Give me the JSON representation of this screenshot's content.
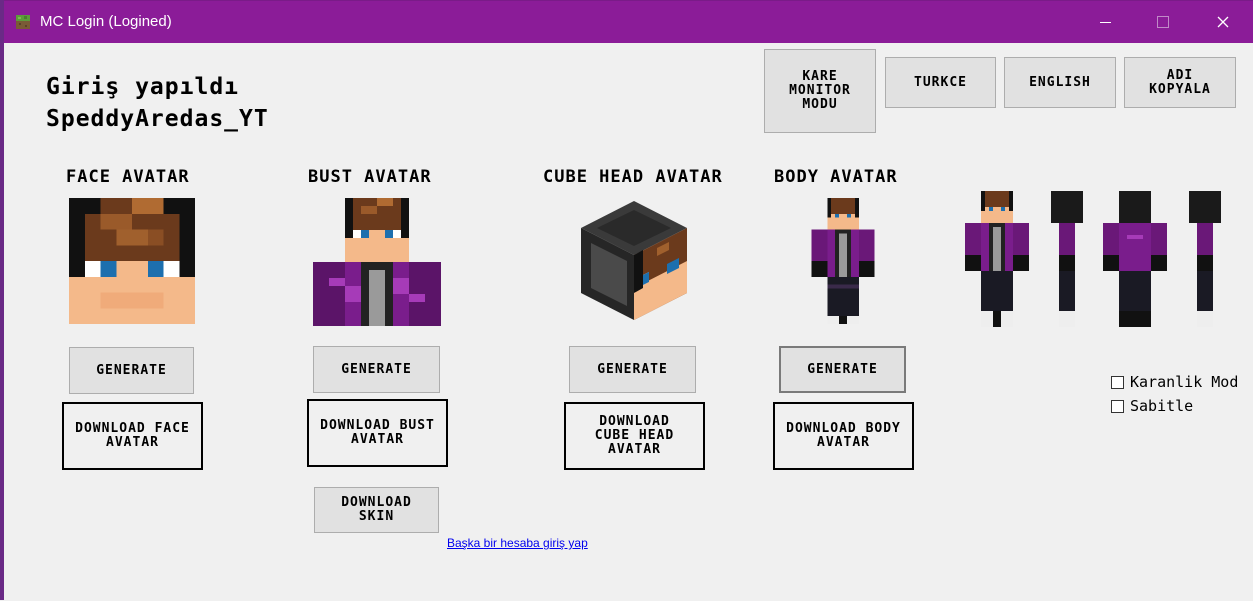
{
  "window": {
    "title": "MC Login (Logined)"
  },
  "status": {
    "line1": "Giriş yapıldı",
    "username": "SpeddyAredas_YT"
  },
  "top_buttons": {
    "square_monitor": "KARE MONITOR MODU",
    "turkce": "TURKCE",
    "english": "ENGLISH",
    "copy_name": "ADI KOPYALA"
  },
  "sections": {
    "face": {
      "title": "FACE AVATAR",
      "generate": "GENERATE",
      "download": "DOWNLOAD FACE AVATAR"
    },
    "bust": {
      "title": "BUST AVATAR",
      "generate": "GENERATE",
      "download": "DOWNLOAD BUST AVATAR",
      "download_skin": "DOWNLOAD SKIN"
    },
    "cube": {
      "title": "CUBE HEAD AVATAR",
      "generate": "GENERATE",
      "download": "DOWNLOAD CUBE HEAD AVATAR"
    },
    "body": {
      "title": "BODY AVATAR",
      "generate": "GENERATE",
      "download": "DOWNLOAD BODY AVATAR"
    }
  },
  "options": {
    "dark_mode": {
      "label": "Karanlik Mod",
      "checked": false
    },
    "pinned": {
      "label": "Sabitle",
      "checked": false
    }
  },
  "switch_account_link": "Başka bir hesaba giriş yap"
}
